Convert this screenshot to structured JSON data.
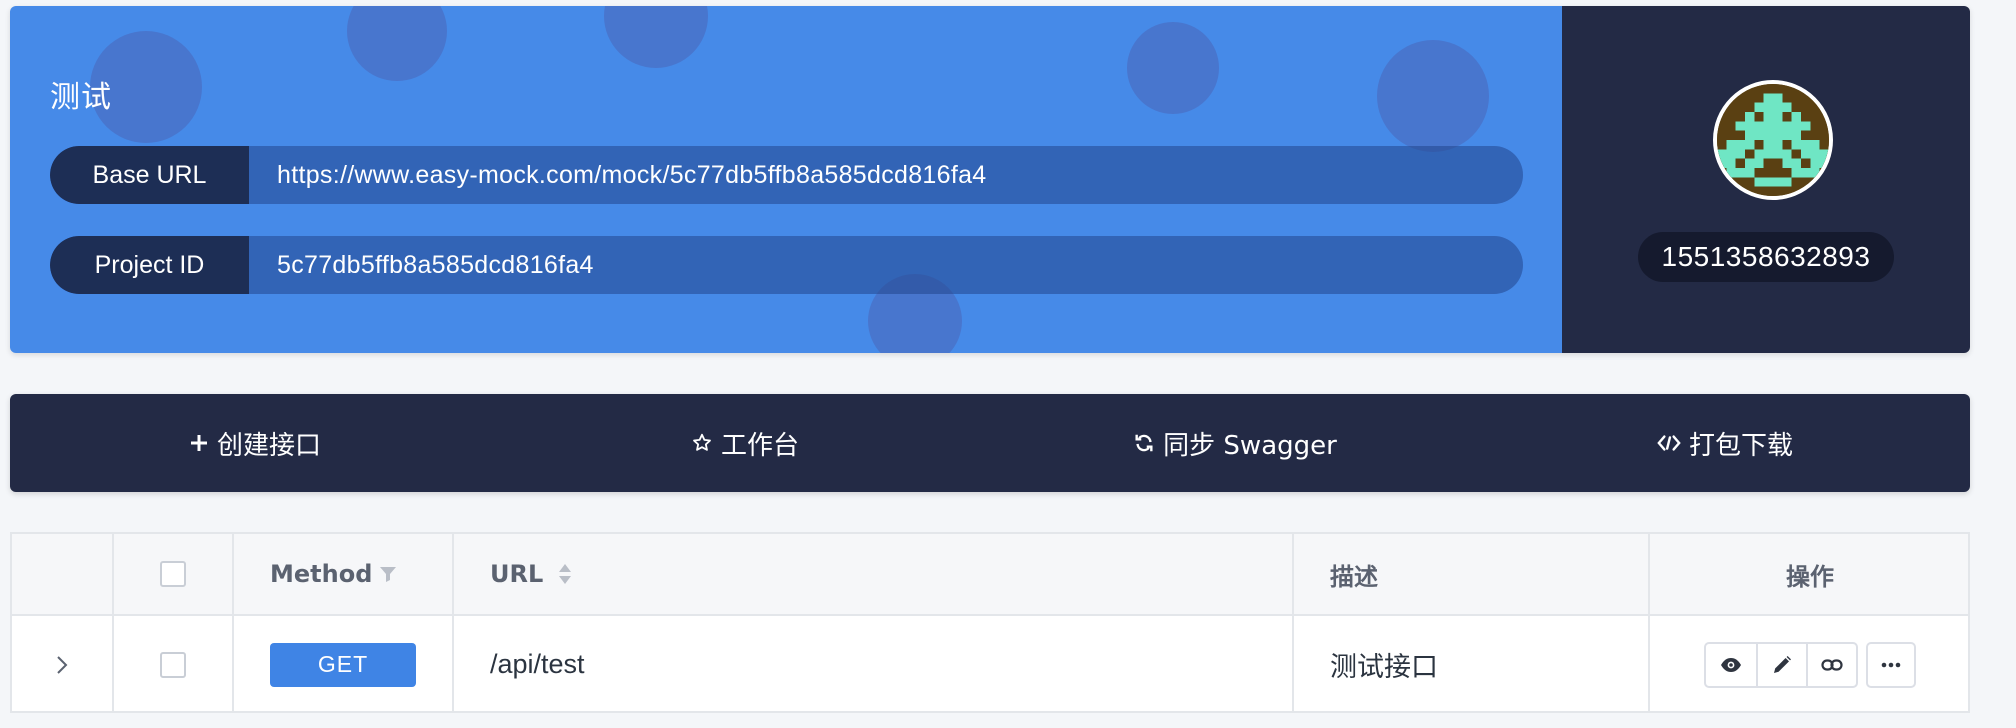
{
  "project": {
    "name": "测试",
    "base_url_label": "Base URL",
    "base_url": "https://www.easy-mock.com/mock/5c77db5ffb8a585dcd816fa4",
    "project_id_label": "Project ID",
    "project_id": "5c77db5ffb8a585dcd816fa4"
  },
  "user": {
    "id": "1551358632893",
    "avatar_icon": "pixel-invader-avatar"
  },
  "toolbar": {
    "create_label": "创建接口",
    "workbench_label": "工作台",
    "sync_label": "同步 Swagger",
    "download_label": "打包下载"
  },
  "table": {
    "headers": {
      "method": "Method",
      "url": "URL",
      "desc": "描述",
      "actions": "操作"
    },
    "rows": [
      {
        "method": "GET",
        "url": "/api/test",
        "desc": "测试接口"
      }
    ]
  },
  "colors": {
    "header_blue": "#468ae8",
    "dark_navy": "#232a45",
    "method_get": "#3f84e5"
  }
}
